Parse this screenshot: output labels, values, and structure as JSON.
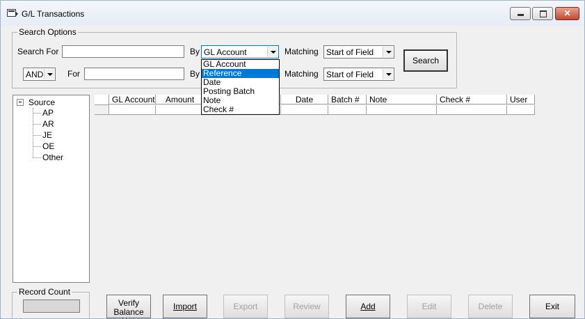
{
  "window": {
    "title": "G/L Transactions"
  },
  "search_options": {
    "legend": "Search Options",
    "row1": {
      "search_for_label": "Search For",
      "search_for_value": "",
      "by_label": "By",
      "by_value": "GL Account",
      "matching_label": "Matching",
      "matching_value": "Start of Field"
    },
    "row2": {
      "operator_value": "AND",
      "for_label": "For",
      "for_value": "",
      "by_label": "By",
      "matching_label": "Matching",
      "matching_value": "Start of Field"
    },
    "search_button": "Search",
    "by_dropdown_options": [
      "GL Account",
      "Reference",
      "Date",
      "Posting Batch",
      "Note",
      "Check #"
    ],
    "by_dropdown_selected": "Reference"
  },
  "tree": {
    "root": "Source",
    "children": [
      "AP",
      "AR",
      "JE",
      "OE",
      "Other"
    ]
  },
  "grid": {
    "columns": [
      "GL Account",
      "Amount",
      "",
      "Date",
      "Batch #",
      "Note",
      "Check #",
      "User"
    ]
  },
  "record_count": {
    "legend": "Record Count",
    "value": ""
  },
  "buttons": {
    "verify_line1": "Verify",
    "verify_line2": "Balance",
    "import": "Import",
    "export": "Export",
    "review": "Review",
    "add": "Add",
    "edit": "Edit",
    "delete": "Delete",
    "exit": "Exit"
  },
  "colors": {
    "selection": "#0078d7",
    "close_button": "#c24a33"
  }
}
